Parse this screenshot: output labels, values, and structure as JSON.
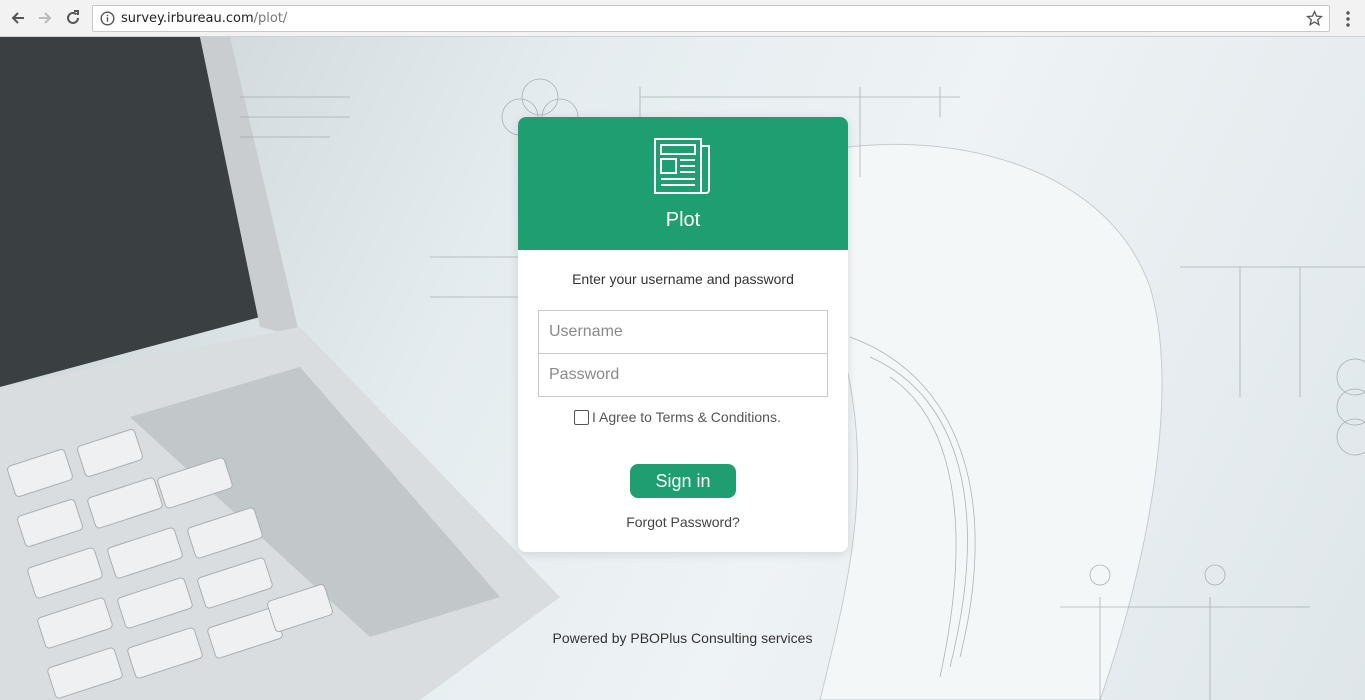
{
  "browser": {
    "url_host": "survey.irbureau.com",
    "url_path": "/plot/"
  },
  "login": {
    "app_title": "Plot",
    "prompt": "Enter your username and password",
    "username_placeholder": "Username",
    "password_placeholder": "Password",
    "agree_label": "I Agree to Terms & Conditions.",
    "signin_label": "Sign in",
    "forgot_label": "Forgot Password?"
  },
  "footer": {
    "powered_by": "Powered by PBOPlus Consulting services"
  },
  "colors": {
    "brand_green": "#1f9e72"
  },
  "icons": {
    "logo": "newspaper-icon"
  }
}
